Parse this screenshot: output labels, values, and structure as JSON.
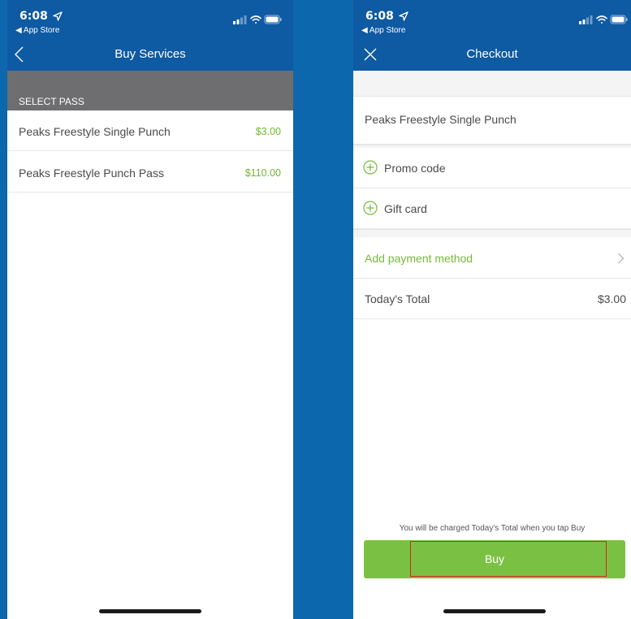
{
  "status_bar": {
    "time": "6:08",
    "back_label": "◀ App Store"
  },
  "buy_services": {
    "title": "Buy Services",
    "section_header": "SELECT PASS",
    "passes": [
      {
        "name": "Peaks Freestyle Single Punch",
        "price": "$3.00"
      },
      {
        "name": "Peaks Freestyle Punch Pass",
        "price": "$110.00"
      }
    ]
  },
  "checkout": {
    "title": "Checkout",
    "item_name": "Peaks Freestyle Single Punch",
    "promo_label": "Promo code",
    "gift_label": "Gift card",
    "add_payment_label": "Add payment method",
    "total_label": "Today's Total",
    "total_value": "$3.00",
    "disclaimer": "You will be charged Today's Total when you tap Buy",
    "buy_label": "Buy"
  },
  "colors": {
    "header_blue": "#0e5aa3",
    "background_blue": "#0d67ad",
    "accent_green": "#7ac143",
    "price_green": "#70b832",
    "highlight_red": "#d9261c"
  },
  "icons": {
    "location": "location-arrow-icon",
    "signal": "cellular-signal-icon",
    "wifi": "wifi-icon",
    "battery": "battery-icon",
    "back": "chevron-left-icon",
    "close": "close-icon",
    "add": "plus-circle-icon",
    "disclosure": "chevron-right-icon"
  }
}
